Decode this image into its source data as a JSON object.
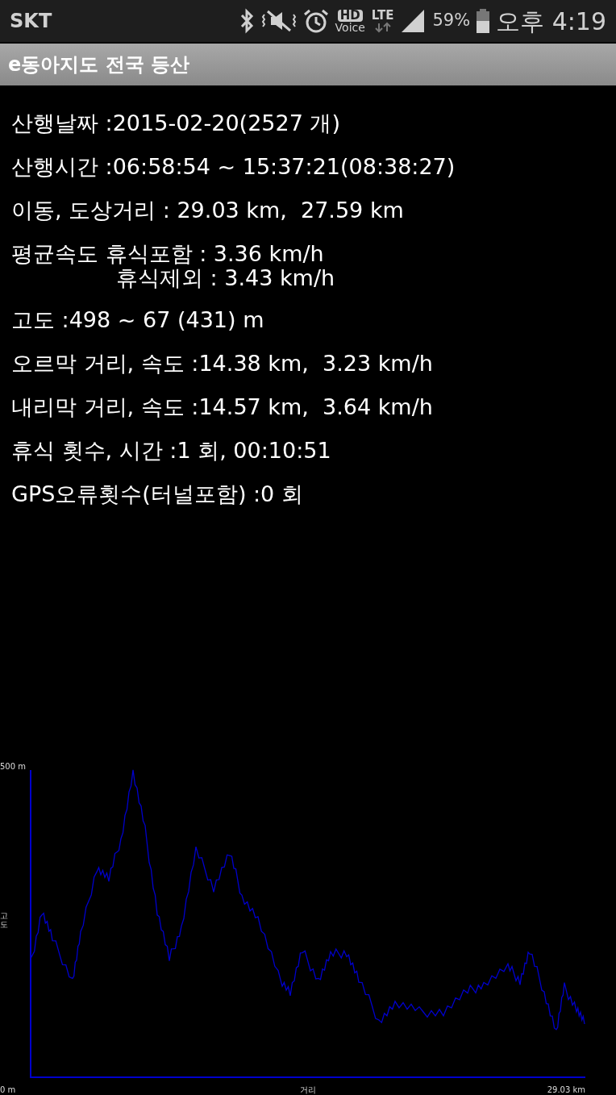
{
  "status_bar": {
    "carrier": "SKT",
    "hd_label": "HD",
    "voice_label": "Voice",
    "network": "LTE",
    "battery": "59%",
    "time": "오후 4:19"
  },
  "app_bar": {
    "title": "e동아지도 전국 등산"
  },
  "stats": [
    {
      "kind": "main",
      "label": "산행날짜 :",
      "value": "2015-02-20(2527 개)"
    },
    {
      "kind": "main",
      "label": "산행시간 :",
      "value": "06:58:54 ~ 15:37:21(08:38:27)"
    },
    {
      "kind": "main",
      "label": "이동, 도상거리 :",
      "value": " 29.03 km,  27.59 km"
    },
    {
      "kind": "main",
      "label": "평균속도 휴식포함 :",
      "value": " 3.36 km/h"
    },
    {
      "kind": "sub",
      "label": "휴식제외 :",
      "value": " 3.43 km/h"
    },
    {
      "kind": "main",
      "label": "고도 :",
      "value": "498 ~ 67 (431) m"
    },
    {
      "kind": "main",
      "label": "오르막 거리, 속도 :",
      "value": "14.38 km,  3.23 km/h"
    },
    {
      "kind": "main",
      "label": "내리막 거리, 속도 :",
      "value": "14.57 km,  3.64 km/h"
    },
    {
      "kind": "main",
      "label": "휴식 횟수, 시간 :",
      "value": "1 회, 00:10:51"
    },
    {
      "kind": "main",
      "label": "GPS오류횟수(터널포함) :",
      "value": "0 회"
    }
  ],
  "elevation_chart": {
    "y_max_label": "500 m",
    "y_axis_title": "고도",
    "x_start_label": "0 m",
    "x_axis_title": "거리",
    "x_end_label": "29.03 km"
  }
}
